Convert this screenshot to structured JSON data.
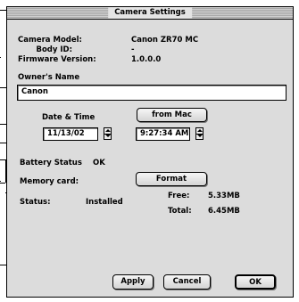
{
  "window": {
    "title": "Camera Settings"
  },
  "info": {
    "camera_model_label": "Camera Model:",
    "camera_model_value": "Canon ZR70 MC",
    "body_id_label": "Body ID:",
    "body_id_value": "-",
    "firmware_label": "Firmware Version:",
    "firmware_value": "1.0.0.0"
  },
  "owner": {
    "label": "Owner's Name",
    "value": "Canon"
  },
  "datetime": {
    "label": "Date & Time",
    "from_mac_label": "from Mac",
    "date_value": "11/13/02",
    "time_value": "9:27:34 AM"
  },
  "battery": {
    "label": "Battery Status",
    "value": "OK"
  },
  "memory": {
    "label": "Memory card:",
    "format_label": "Format",
    "status_label": "Status:",
    "status_value": "Installed",
    "free_label": "Free:",
    "free_value": "5.33MB",
    "total_label": "Total:",
    "total_value": "6.45MB"
  },
  "buttons": {
    "apply": "Apply",
    "cancel": "Cancel",
    "ok": "OK"
  }
}
